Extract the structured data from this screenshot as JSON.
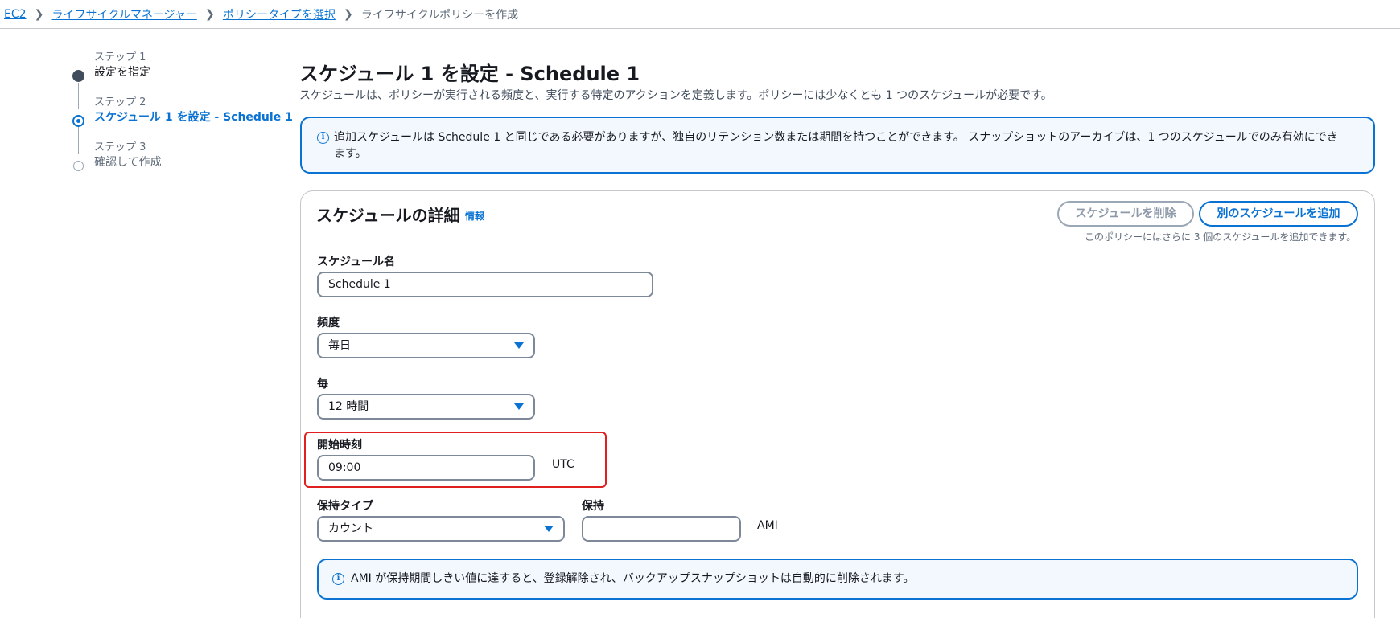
{
  "breadcrumb": {
    "items": [
      "EC2",
      "ライフサイクルマネージャー",
      "ポリシータイプを選択"
    ],
    "current": "ライフサイクルポリシーを作成"
  },
  "steps": [
    {
      "caption": "ステップ 1",
      "title": "設定を指定",
      "state": "done"
    },
    {
      "caption": "ステップ 2",
      "title": "スケジュール 1 を設定 - Schedule 1",
      "state": "active"
    },
    {
      "caption": "ステップ 3",
      "title": "確認して作成",
      "state": "pending"
    }
  ],
  "main": {
    "title": "スケジュール 1 を設定 - Schedule 1",
    "description": "スケジュールは、ポリシーが実行される頻度と、実行する特定のアクションを定義します。ポリシーには少なくとも 1 つのスケジュールが必要です。",
    "info_alert": "追加スケジュールは Schedule 1 と同じである必要がありますが、独自のリテンション数または期間を持つことができます。 スナップショットのアーカイブは、1 つのスケジュールでのみ有効にできます。"
  },
  "schedule_details": {
    "title": "スケジュールの詳細",
    "info_link": "情報",
    "delete_button": "スケジュールを削除",
    "add_button": "別のスケジュールを追加",
    "add_hint": "このポリシーにはさらに 3 個のスケジュールを追加できます。",
    "name_label": "スケジュール名",
    "name_value": "Schedule 1",
    "frequency_label": "頻度",
    "frequency_value": "毎日",
    "every_label": "毎",
    "every_value": "12 時間",
    "start_label": "開始時刻",
    "start_value": "09:00",
    "start_unit": "UTC",
    "retention_type_label": "保持タイプ",
    "retention_type_value": "カウント",
    "retention_label": "保持",
    "retention_value": "",
    "retention_unit": "AMI",
    "ami_alert": "AMI が保持期間しきい値に達すると、登録解除され、バックアップスナップショットは自動的に削除されます。"
  },
  "colors": {
    "accent": "#0972d3",
    "highlight": "#e0201f",
    "info_bg": "#f2f8fd"
  }
}
